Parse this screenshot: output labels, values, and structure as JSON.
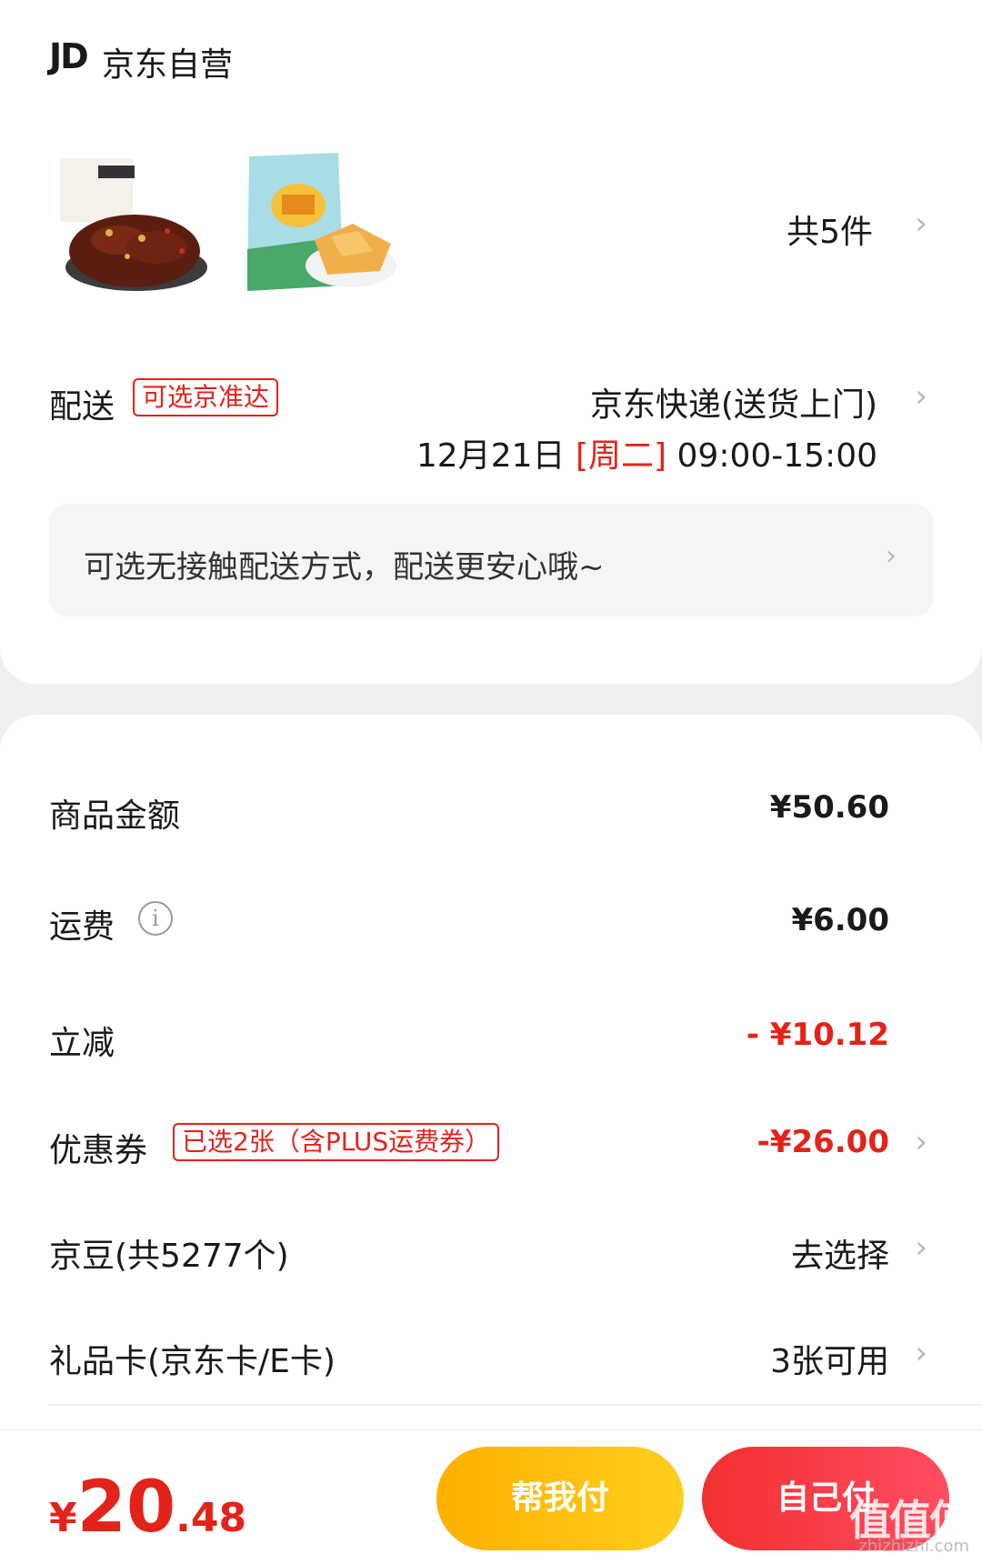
{
  "shop": {
    "logo": "JD",
    "name": "京东自营"
  },
  "products": {
    "items": [
      {
        "name": "麻辣牛肉",
        "icon": "product-beef-image"
      },
      {
        "name": "小米锅巴",
        "icon": "product-snack-image"
      }
    ],
    "count_label": "共5件"
  },
  "delivery": {
    "label": "配送",
    "tag": "可选京准达",
    "method": "京东快递(送货上门)",
    "date": "12月21日",
    "weekday": "[周二]",
    "time": "09:00-15:00",
    "contactless_text": "可选无接触配送方式，配送更安心哦~"
  },
  "summary": {
    "goods_label": "商品金额",
    "goods_value": "¥50.60",
    "shipping_label": "运费",
    "shipping_value": "¥6.00",
    "discount_label": "立减",
    "discount_value": "- ¥10.12",
    "coupon_label": "优惠券",
    "coupon_tag": "已选2张（含PLUS运费券）",
    "coupon_value": "-¥26.00",
    "beans_label": "京豆(共5277个)",
    "beans_value": "去选择",
    "giftcard_label": "礼品卡(京东卡/E卡)",
    "giftcard_value": "3张可用"
  },
  "footer": {
    "currency": "¥",
    "total_int": "20",
    "total_dec": ".48",
    "help_pay": "帮我付",
    "self_pay": "自己付"
  },
  "watermark": {
    "main": "值值值",
    "sub": "zhizhizhi.com"
  },
  "colors": {
    "accent_red": "#e2231a",
    "help_button": "#ffb000",
    "self_button": "#f23030"
  }
}
